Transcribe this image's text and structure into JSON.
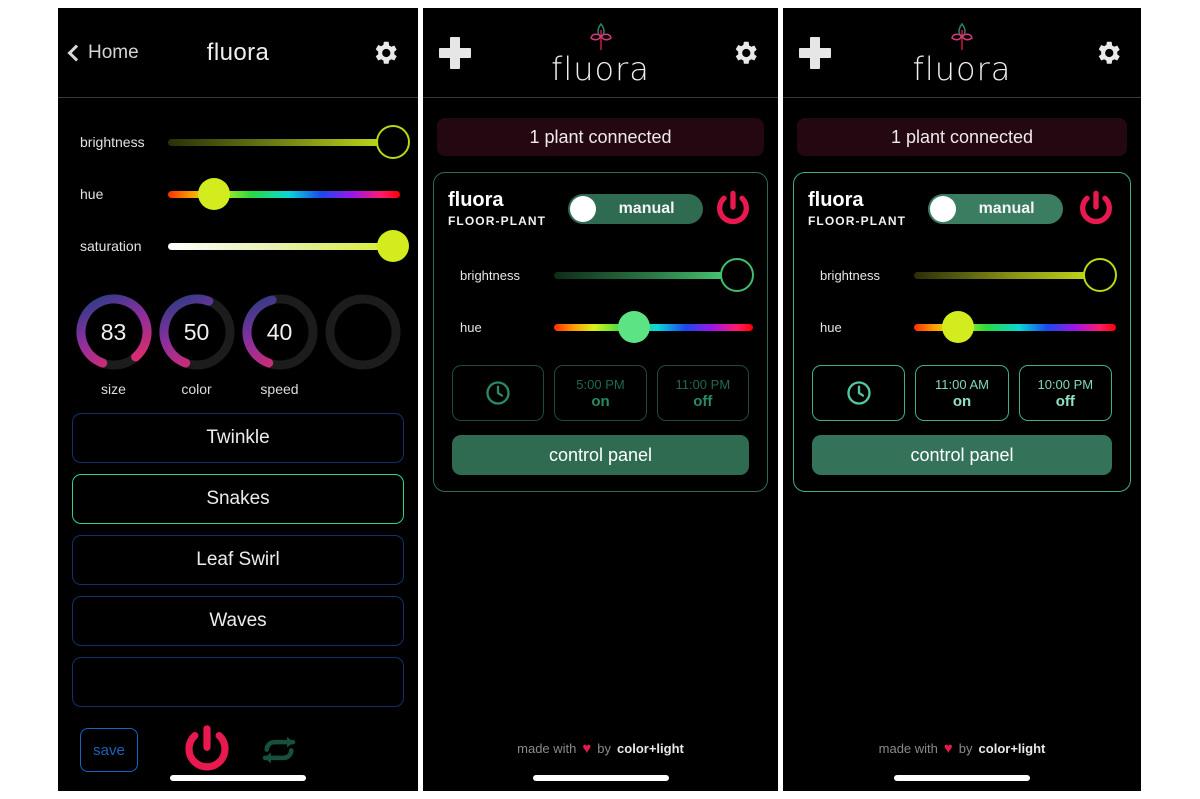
{
  "panel1": {
    "nav": {
      "back_label": "Home",
      "title": "fluora",
      "gear_icon": "gear-icon",
      "back_icon": "chevron-left-icon"
    },
    "sliders": [
      {
        "label": "brightness",
        "value": 97,
        "thumb": "hollow"
      },
      {
        "label": "hue",
        "value": 20,
        "thumb": "solid",
        "thumb_color": "#d2ec1e"
      },
      {
        "label": "saturation",
        "value": 97,
        "thumb": "solid",
        "thumb_color": "#d2ec1e"
      }
    ],
    "dials": [
      {
        "label": "size",
        "value": "83",
        "percent": 83
      },
      {
        "label": "color",
        "value": "50",
        "percent": 50
      },
      {
        "label": "speed",
        "value": "40",
        "percent": 40
      },
      {
        "label": "",
        "value": "",
        "percent": 0
      }
    ],
    "effects": [
      {
        "label": "Twinkle",
        "selected": false
      },
      {
        "label": "Snakes",
        "selected": true
      },
      {
        "label": "Leaf Swirl",
        "selected": false
      },
      {
        "label": "Waves",
        "selected": false
      },
      {
        "label": "",
        "selected": false
      }
    ],
    "bottom": {
      "save_label": "save",
      "power_icon": "power-icon",
      "refresh_icon": "refresh-icon"
    }
  },
  "panel2": {
    "nav": {
      "add_icon": "plus-icon",
      "brand": "fluora",
      "gear_icon": "gear-icon",
      "sprout_icon": "sprout-icon"
    },
    "status": "1 plant connected",
    "card": {
      "title": "fluora",
      "subtitle": "FLOOR-PLANT",
      "toggle_label": "manual",
      "power_icon": "power-icon",
      "sliders": [
        {
          "label": "brightness",
          "value": 92,
          "thumb": "hollow"
        },
        {
          "label": "hue",
          "value": 40,
          "thumb": "solid",
          "thumb_color": "#5ce383"
        }
      ],
      "schedule": [
        {
          "icon": "clock-icon"
        },
        {
          "time": "5:00 PM",
          "state": "on"
        },
        {
          "time": "11:00 PM",
          "state": "off"
        }
      ],
      "control_label": "control panel"
    },
    "footer": {
      "prefix": "made with",
      "heart": "♥",
      "by": "by",
      "brand": "color+light"
    }
  },
  "panel3": {
    "nav": {
      "add_icon": "plus-icon",
      "brand": "fluora",
      "gear_icon": "gear-icon",
      "sprout_icon": "sprout-icon"
    },
    "status": "1 plant connected",
    "card": {
      "title": "fluora",
      "subtitle": "FLOOR-PLANT",
      "toggle_label": "manual",
      "power_icon": "power-icon",
      "sliders": [
        {
          "label": "brightness",
          "value": 92,
          "thumb": "hollow"
        },
        {
          "label": "hue",
          "value": 22,
          "thumb": "solid",
          "thumb_color": "#d2ec1e"
        }
      ],
      "schedule": [
        {
          "icon": "clock-icon"
        },
        {
          "time": "11:00 AM",
          "state": "on"
        },
        {
          "time": "10:00 PM",
          "state": "off"
        }
      ],
      "control_label": "control panel"
    },
    "footer": {
      "prefix": "made with",
      "heart": "♥",
      "by": "by",
      "brand": "color+light"
    }
  },
  "colors": {
    "accent_pink": "#e8194f",
    "accent_teal": "#2f6b51",
    "accent_green": "#2fd38a",
    "accent_blue": "#10316b",
    "badge_bg": "#230811",
    "lime": "#d2ec1e"
  }
}
